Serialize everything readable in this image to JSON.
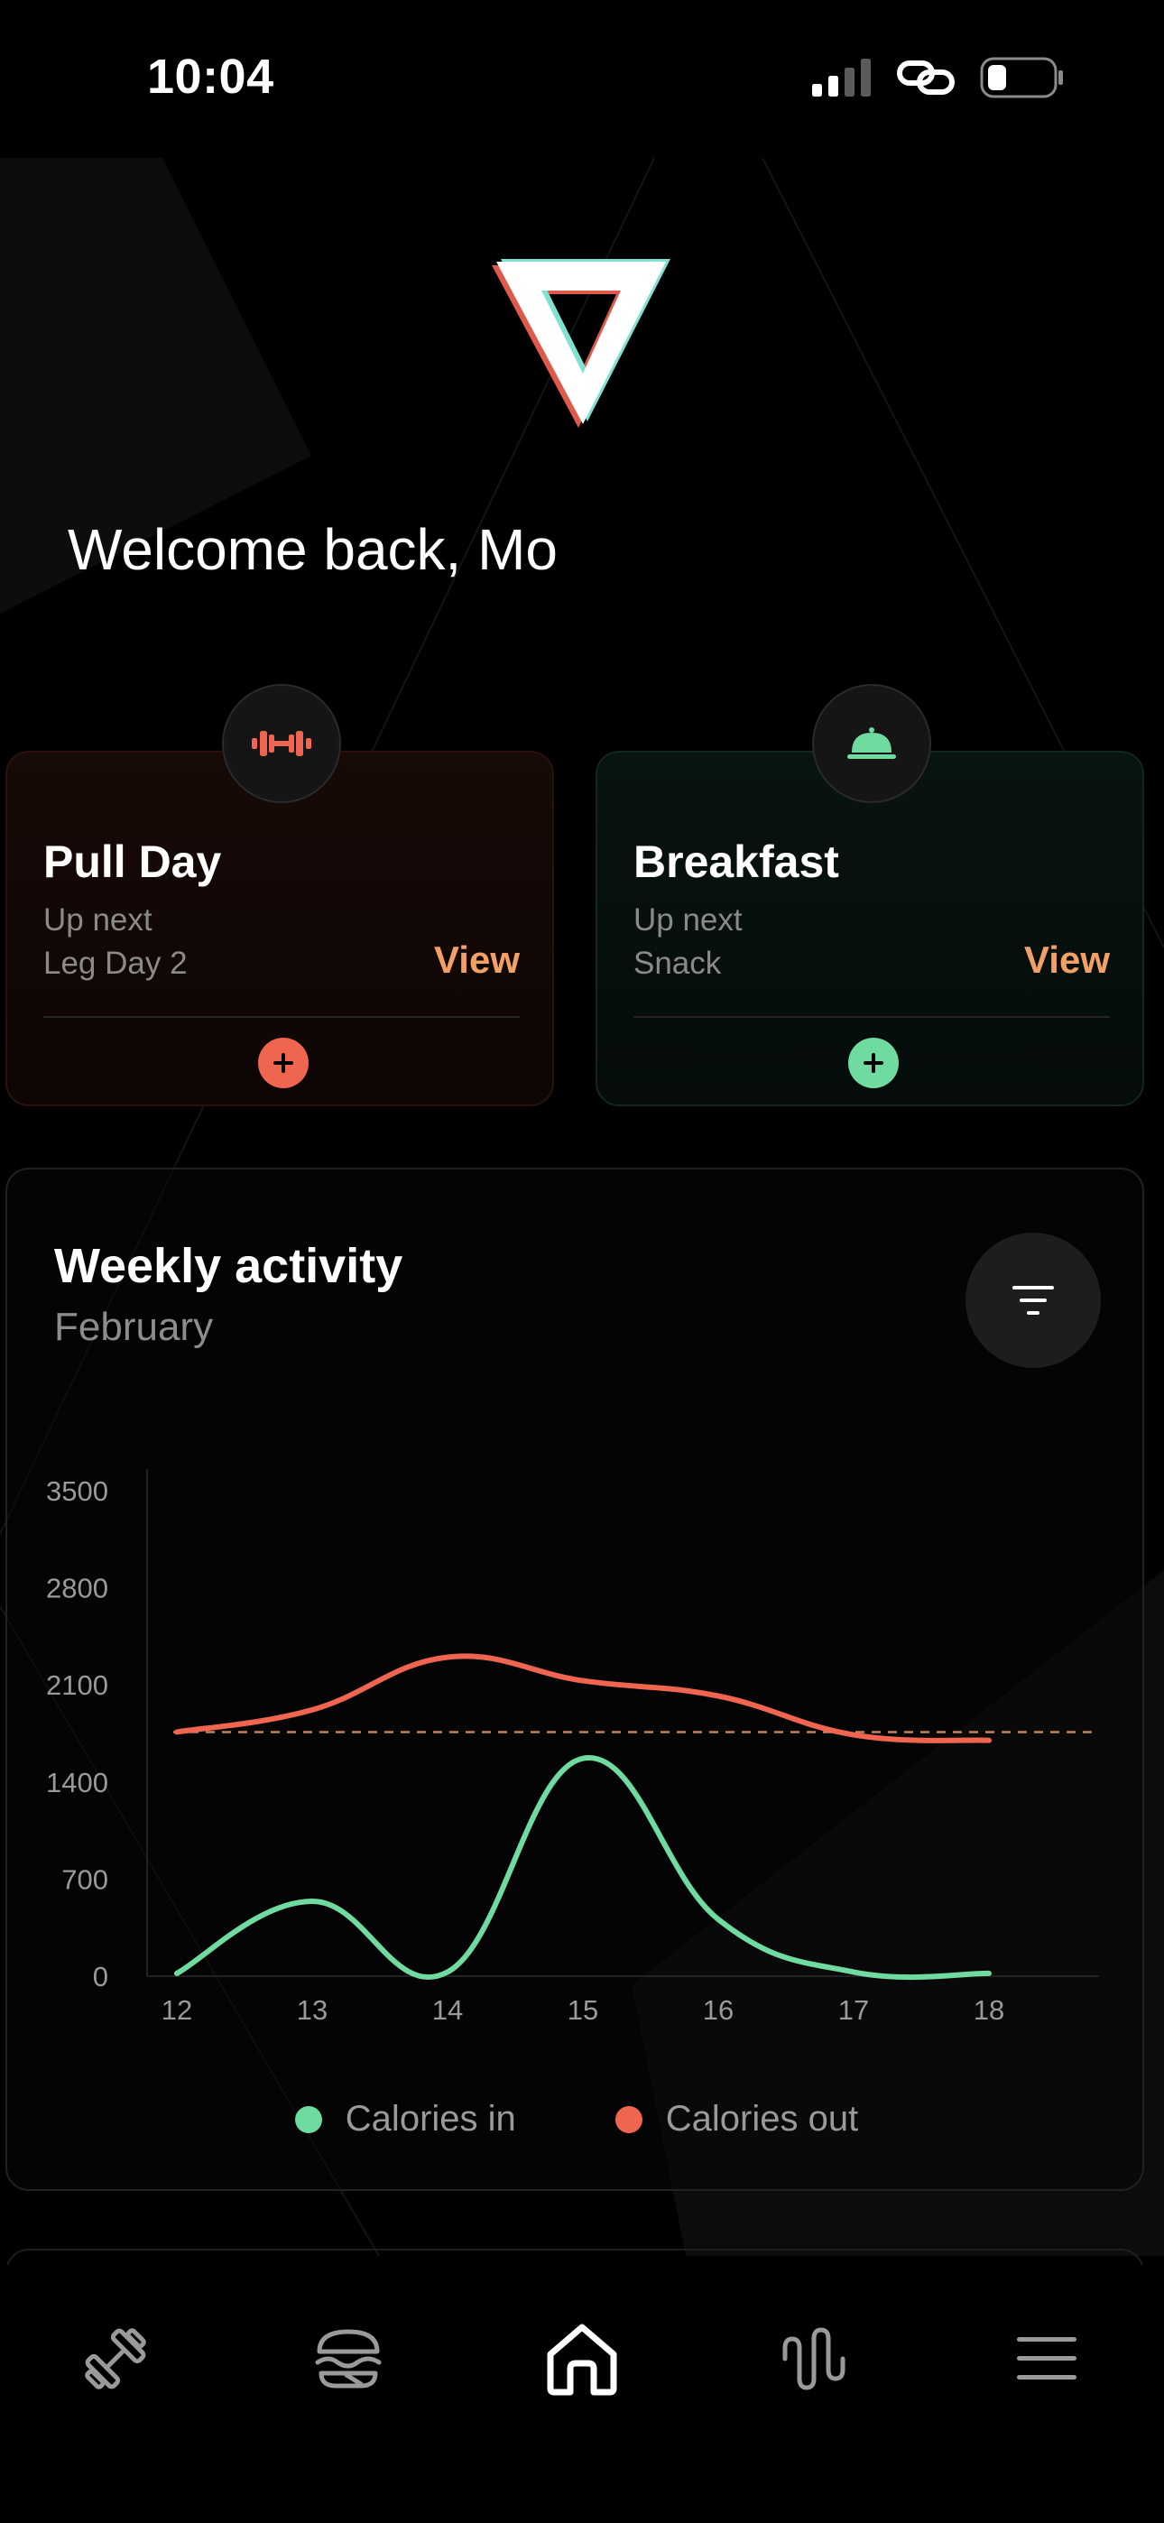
{
  "status_bar": {
    "time": "10:04",
    "icons": [
      "cellular-signal-icon",
      "link-icon",
      "battery-icon"
    ]
  },
  "header": {
    "logo": "triangle-logo",
    "welcome": "Welcome back, Mo"
  },
  "cards": [
    {
      "icon": "dumbbell-icon",
      "title": "Pull Day",
      "subtitle": "Up next",
      "next": "Leg Day 2",
      "action": "View",
      "accent": "#f0654f"
    },
    {
      "icon": "food-cloche-icon",
      "title": "Breakfast",
      "subtitle": "Up next",
      "next": "Snack",
      "action": "View",
      "accent": "#6fdba0"
    }
  ],
  "activity": {
    "title": "Weekly activity",
    "month": "February",
    "filter_icon": "filter-icon"
  },
  "chart_data": {
    "type": "line",
    "x": [
      12,
      13,
      14,
      15,
      16,
      17,
      18
    ],
    "ylim": [
      0,
      3500
    ],
    "yticks": [
      0,
      700,
      1400,
      2100,
      2800,
      3500
    ],
    "series": [
      {
        "name": "Calories in",
        "color": "#6fdba0",
        "values": [
          20,
          540,
          30,
          1570,
          410,
          30,
          20
        ]
      },
      {
        "name": "Calories out",
        "color": "#f0654f",
        "values": [
          1760,
          1920,
          2300,
          2130,
          2020,
          1740,
          1700
        ]
      }
    ],
    "reference_line": {
      "value": 1760,
      "color": "#e59a6a",
      "style": "dashed"
    },
    "grid": false
  },
  "colors": {
    "background": "#000000",
    "view_link": "#f3a066",
    "muted_text": "#8a8a8a"
  },
  "nav": {
    "items": [
      {
        "icon": "dumbbell-icon",
        "active": false
      },
      {
        "icon": "burger-icon",
        "active": false
      },
      {
        "icon": "home-icon",
        "active": true
      },
      {
        "icon": "waveform-icon",
        "active": false
      },
      {
        "icon": "menu-icon",
        "active": false
      }
    ]
  }
}
